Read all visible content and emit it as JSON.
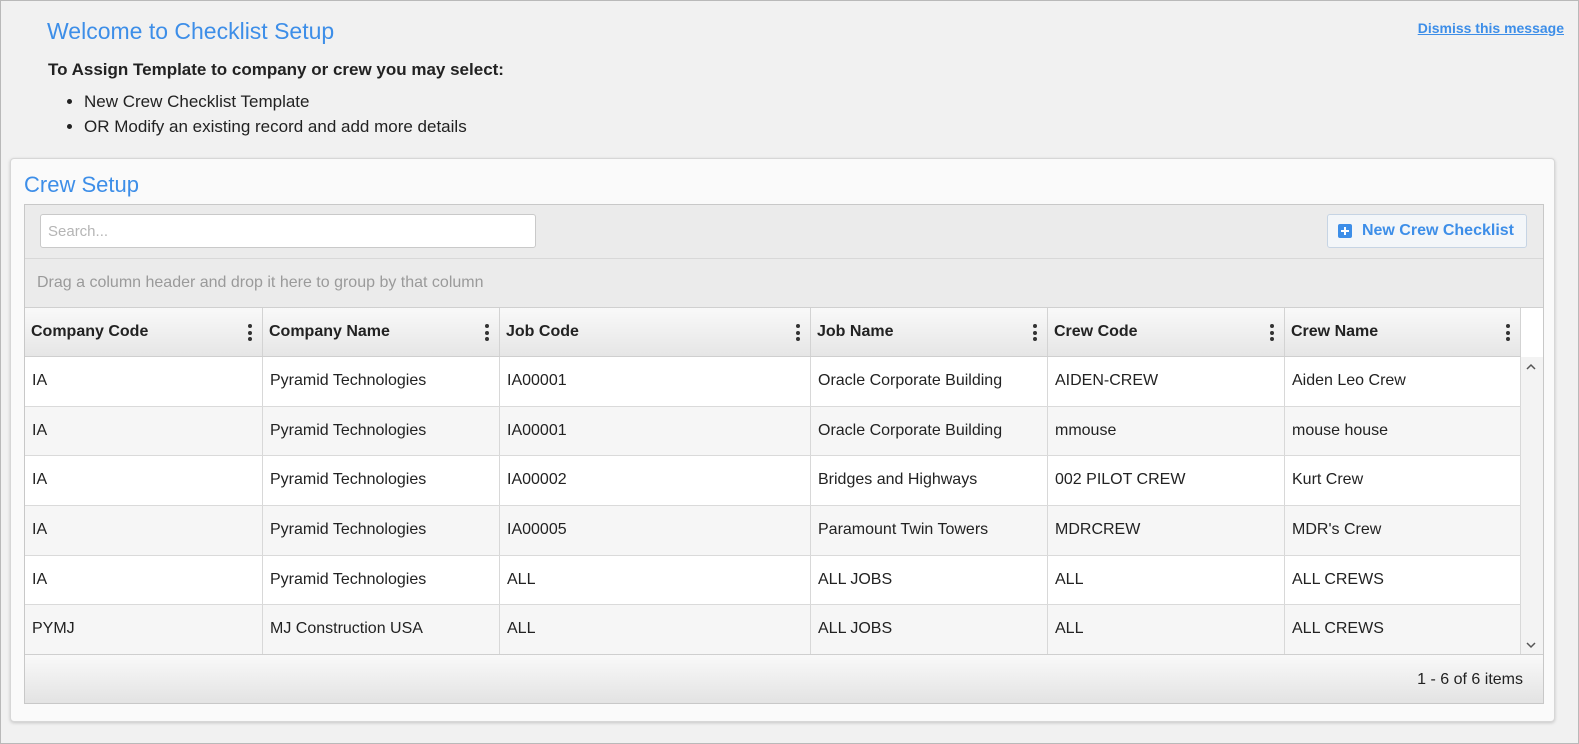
{
  "welcome": {
    "title": "Welcome to Checklist Setup",
    "dismiss_label": "Dismiss this message",
    "instruction_heading": "To Assign Template to company or crew you may select:",
    "instructions": [
      "New Crew Checklist Template",
      "OR Modify an existing record and add more details"
    ]
  },
  "panel": {
    "title": "Crew Setup"
  },
  "toolbar": {
    "search_placeholder": "Search...",
    "search_value": "",
    "new_button_label": "New Crew Checklist"
  },
  "group_bar": {
    "hint": "Drag a column header and drop it here to group by that column"
  },
  "table": {
    "columns": [
      "Company Code",
      "Company Name",
      "Job Code",
      "Job Name",
      "Crew Code",
      "Crew Name"
    ],
    "rows": [
      [
        "IA",
        "Pyramid Technologies",
        "IA00001",
        "Oracle Corporate Building",
        "AIDEN-CREW",
        "Aiden Leo Crew"
      ],
      [
        "IA",
        "Pyramid Technologies",
        "IA00001",
        "Oracle Corporate Building",
        "mmouse",
        "mouse house"
      ],
      [
        "IA",
        "Pyramid Technologies",
        "IA00002",
        "Bridges and Highways",
        "002 PILOT CREW",
        "Kurt Crew"
      ],
      [
        "IA",
        "Pyramid Technologies",
        "IA00005",
        "Paramount Twin Towers",
        "MDRCREW",
        "MDR's Crew"
      ],
      [
        "IA",
        "Pyramid Technologies",
        "ALL",
        "ALL JOBS",
        "ALL",
        "ALL CREWS"
      ],
      [
        "PYMJ",
        "MJ Construction USA",
        "ALL",
        "ALL JOBS",
        "ALL",
        "ALL CREWS"
      ]
    ]
  },
  "pager": {
    "info": "1 - 6 of 6 items"
  },
  "colors": {
    "accent": "#3d8ee8"
  }
}
